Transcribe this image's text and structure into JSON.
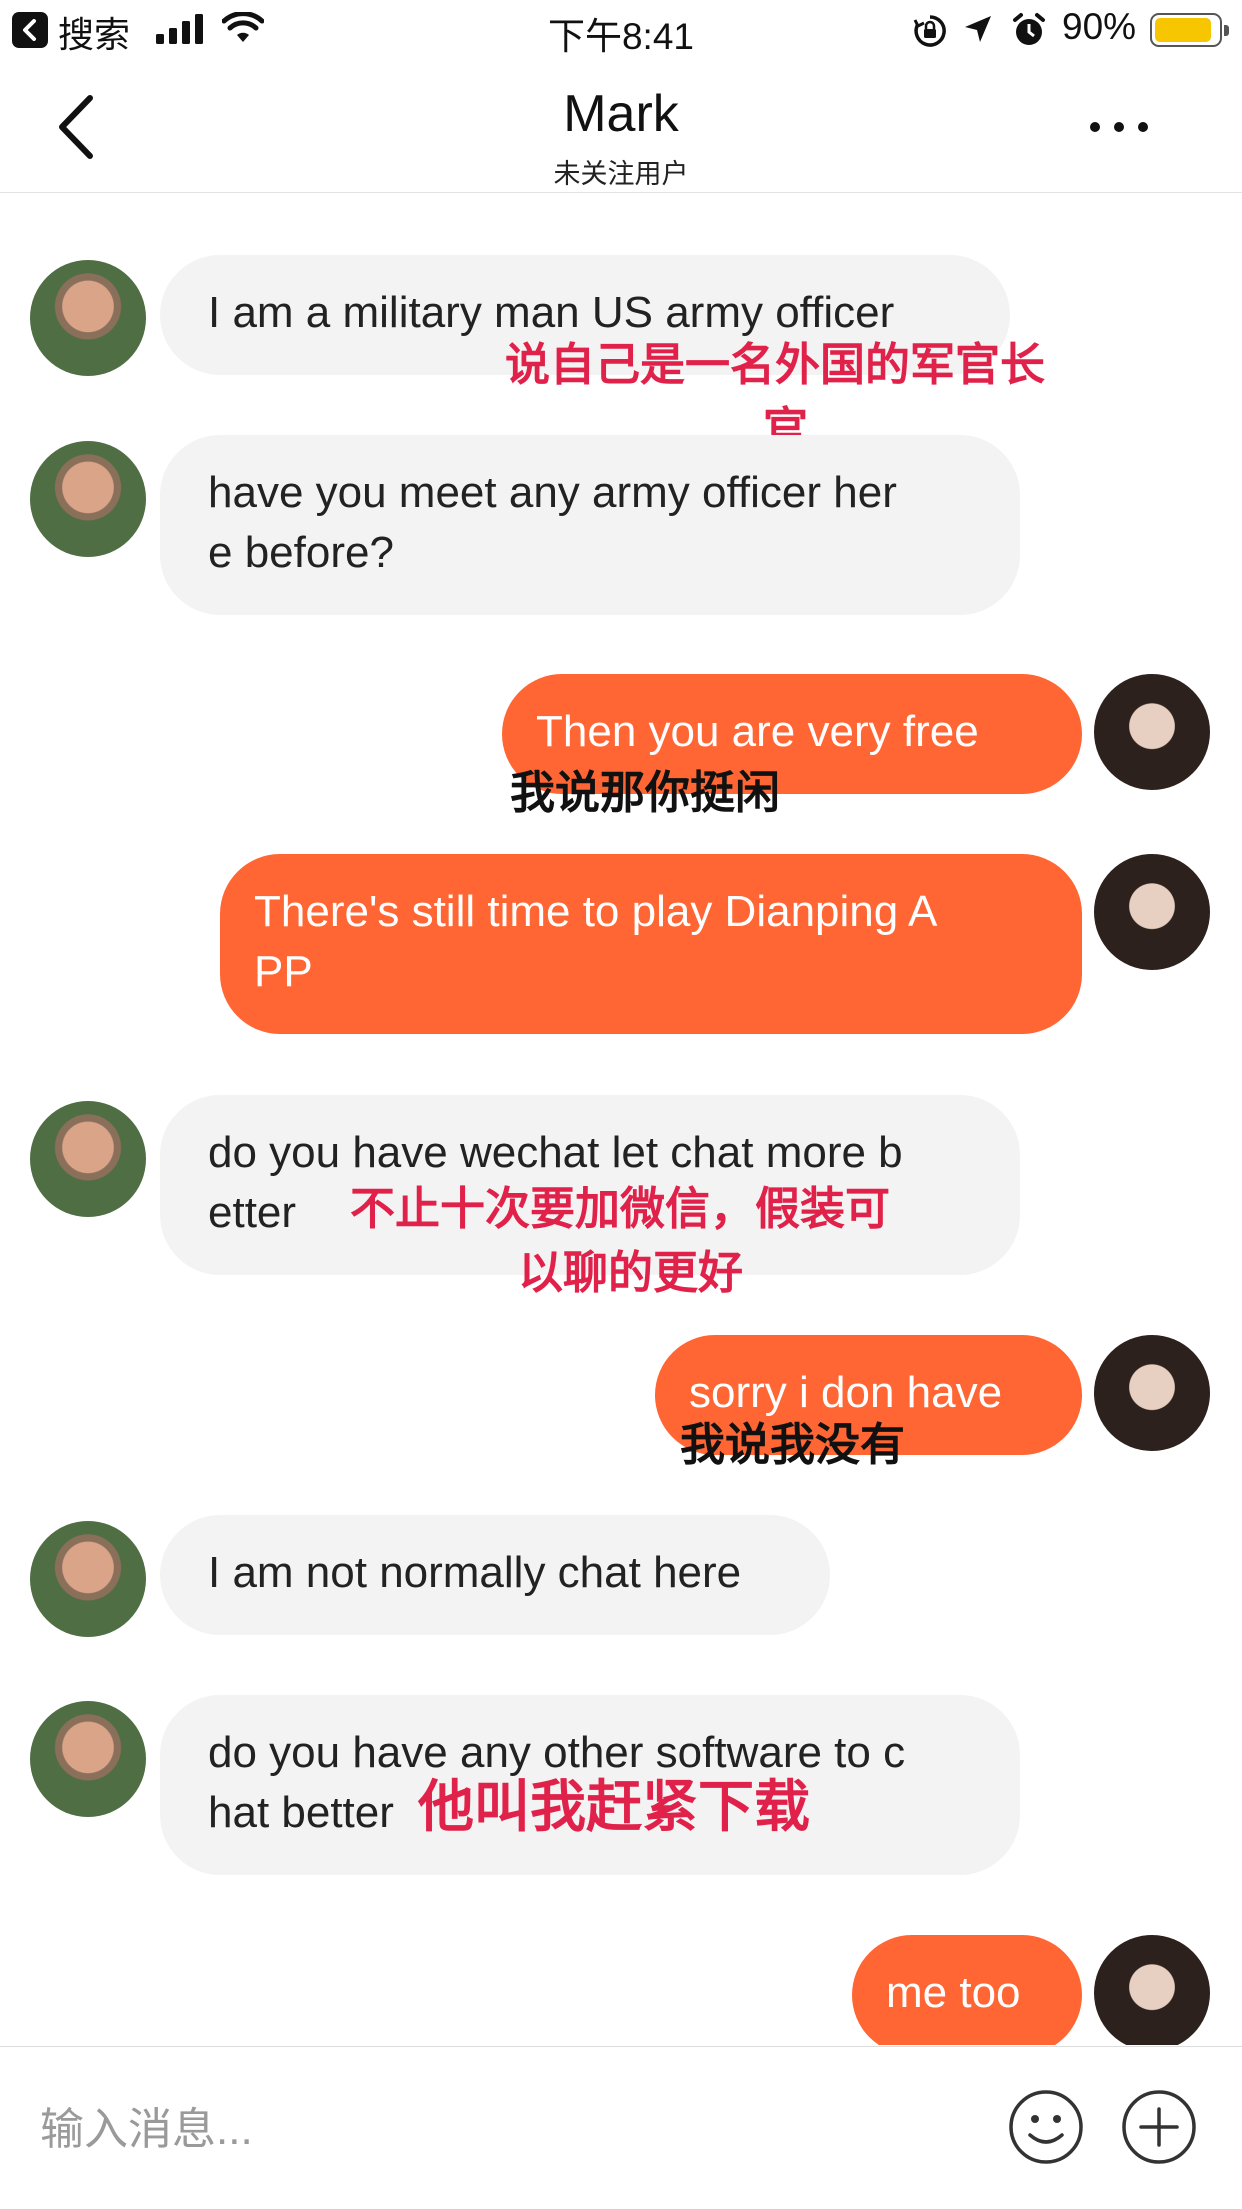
{
  "status_bar": {
    "back_app": "搜索",
    "time": "下午8:41",
    "battery_pct": "90%",
    "battery_level": 0.9,
    "icons": [
      "back-app-icon",
      "signal-icon",
      "wifi-icon",
      "orientation-lock-icon",
      "location-icon",
      "alarm-icon",
      "battery-icon"
    ]
  },
  "nav": {
    "title": "Mark",
    "subtitle": "未关注用户",
    "icons": [
      "back-chevron-icon",
      "more-icon"
    ]
  },
  "messages": [
    {
      "from": "Mark",
      "text": "I am a military man US army officer"
    },
    {
      "from": "Mark",
      "text": "have you meet any army officer her\ne before?"
    },
    {
      "from": "me",
      "text": "Then you are very free"
    },
    {
      "from": "me",
      "text": "There's still time to play Dianping A\nPP"
    },
    {
      "from": "Mark",
      "text": "do you have wechat let chat more b\netter"
    },
    {
      "from": "me",
      "text": "sorry i don have"
    },
    {
      "from": "Mark",
      "text": "I am not normally chat here"
    },
    {
      "from": "Mark",
      "text": "do you have any other software to c\nhat better"
    },
    {
      "from": "me",
      "text": "me too"
    }
  ],
  "annotations": [
    {
      "text": "说自己是一名外国的军官长",
      "color": "#e0224a"
    },
    {
      "text": "官",
      "color": "#e0224a"
    },
    {
      "text": "我说那你挺闲",
      "color": "#111111"
    },
    {
      "text": "不止十次要加微信，假装可",
      "color": "#e0224a"
    },
    {
      "text": "以聊的更好",
      "color": "#e0224a"
    },
    {
      "text": "我说我没有",
      "color": "#111111"
    },
    {
      "text": "他叫我赶紧下载",
      "color": "#e0224a"
    }
  ],
  "input_bar": {
    "placeholder": "输入消息...",
    "icons": [
      "emoji-icon",
      "plus-icon"
    ]
  },
  "colors": {
    "outgoing_bubble": "#ff6633",
    "incoming_bubble": "#f3f3f3",
    "annotation_red": "#e0224a",
    "battery": "#f7c600"
  }
}
